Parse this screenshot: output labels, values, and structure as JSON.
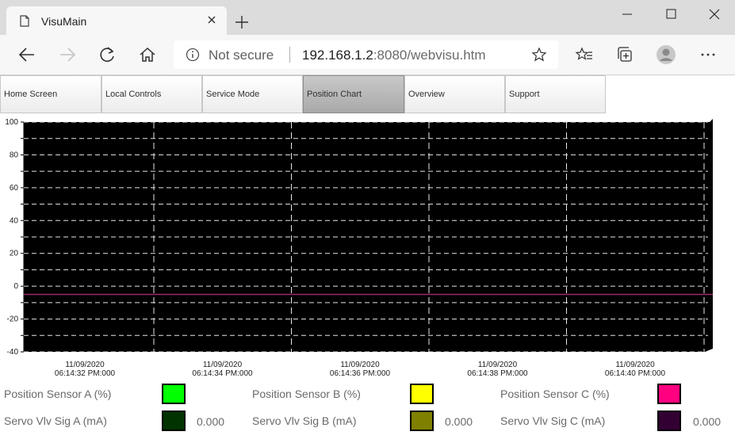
{
  "browser": {
    "tab_title": "VisuMain",
    "not_secure": "Not secure",
    "url_host": "192.168.1.2",
    "url_rest": ":8080/webvisu.htm"
  },
  "app_tabs": [
    {
      "label": "Home Screen",
      "active": false
    },
    {
      "label": "Local Controls",
      "active": false
    },
    {
      "label": "Service Mode",
      "active": false
    },
    {
      "label": "Position Chart",
      "active": true
    },
    {
      "label": "Overview",
      "active": false
    },
    {
      "label": "Support",
      "active": false
    }
  ],
  "chart_data": {
    "type": "line",
    "ylim": [
      -40,
      100
    ],
    "y_ticks": [
      "100",
      "80",
      "60",
      "40",
      "20",
      "0",
      "-20",
      "-40"
    ],
    "x_ticks": [
      {
        "date": "11/09/2020",
        "time": "06:14:32 PM:000"
      },
      {
        "date": "11/09/2020",
        "time": "06:14:34 PM:000"
      },
      {
        "date": "11/09/2020",
        "time": "06:14:36 PM:000"
      },
      {
        "date": "11/09/2020",
        "time": "06:14:38 PM:000"
      },
      {
        "date": "11/09/2020",
        "time": "06:14:40 PM:000"
      }
    ],
    "grid": true,
    "background": "#000000",
    "series": [
      {
        "name": "Servo Vlv Sig C (mA)",
        "color": "#a0266e",
        "values": [
          -5,
          -5,
          -5,
          -5,
          -5
        ]
      }
    ]
  },
  "legend": [
    {
      "label": "Position Sensor A (%)",
      "color": "#00ff00",
      "value": ""
    },
    {
      "label": "Position Sensor B (%)",
      "color": "#ffff00",
      "value": ""
    },
    {
      "label": "Position Sensor C (%)",
      "color": "#ff0080",
      "value": ""
    },
    {
      "label": "Servo Vlv Sig A (mA)",
      "color": "#003300",
      "value": "0.000"
    },
    {
      "label": "Servo Vlv Sig B (mA)",
      "color": "#808000",
      "value": "0.000"
    },
    {
      "label": "Servo Vlv Sig C (mA)",
      "color": "#330033",
      "value": "0.000"
    }
  ]
}
